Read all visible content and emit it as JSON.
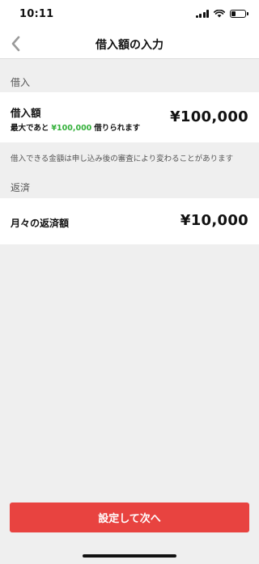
{
  "status_bar": {
    "time": "10:11"
  },
  "nav": {
    "title": "借入額の入力"
  },
  "borrow_section": {
    "header": "借入",
    "label": "借入額",
    "sub_prefix": "最大であと",
    "sub_max": "¥100,000",
    "sub_suffix": "借りられます",
    "amount": "¥100,000",
    "note": "借入できる金額は申し込み後の審査により変わることがあります"
  },
  "repay_section": {
    "header": "返済",
    "label": "月々の返済額",
    "amount": "¥10,000"
  },
  "submit": {
    "label": "設定して次へ"
  },
  "colors": {
    "accent": "#e84340",
    "highlight": "#33b03a"
  }
}
